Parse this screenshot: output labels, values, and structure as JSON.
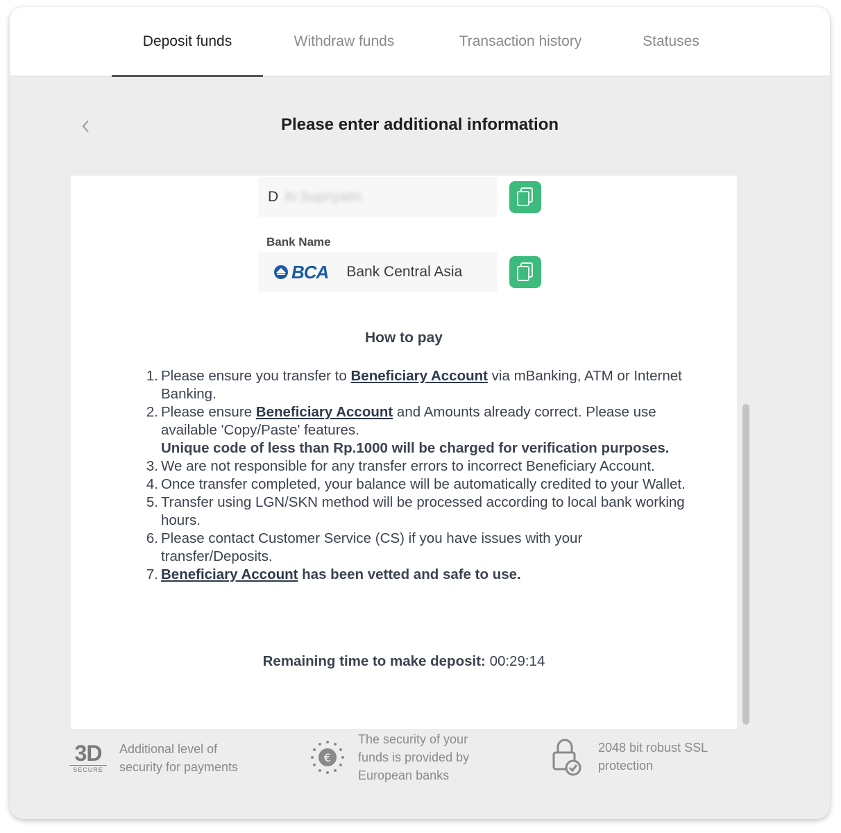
{
  "tabs": [
    {
      "label": "Deposit funds",
      "active": true
    },
    {
      "label": "Withdraw funds",
      "active": false
    },
    {
      "label": "Transaction history",
      "active": false
    },
    {
      "label": "Statuses",
      "active": false
    }
  ],
  "header": {
    "title": "Please enter additional information",
    "back_icon": "chevron-left-icon"
  },
  "account_name": {
    "visible_initial": "D",
    "masked_text": "Ai Supriyatin",
    "copy_icon": "copy-icon"
  },
  "bank": {
    "label": "Bank Name",
    "logo_text": "BCA",
    "name": "Bank Central Asia",
    "copy_icon": "copy-icon"
  },
  "how_to_pay": {
    "title": "How to pay",
    "link_text": "Beneficiary Account",
    "steps": [
      {
        "num": "1.",
        "pre": "Please ensure you transfer to ",
        "post": " via mBanking, ATM or Internet Banking."
      },
      {
        "num": "2.",
        "pre": "Please ensure ",
        "post": " and Amounts already correct. Please use available 'Copy/Paste' features.",
        "bold_note": "Unique code of less than Rp.1000 will be charged for verification purposes."
      },
      {
        "num": "3.",
        "text": "We are not responsible for any transfer errors to incorrect Beneficiary Account."
      },
      {
        "num": "4.",
        "text": "Once transfer completed, your balance will be automatically credited to your Wallet."
      },
      {
        "num": "5.",
        "text": "Transfer using LGN/SKN method will be processed according to local bank working hours."
      },
      {
        "num": "6.",
        "text": "Please contact Customer Service (CS) if you have issues with your transfer/Deposits."
      },
      {
        "num": "7.",
        "post": " has been vetted and safe to use."
      }
    ]
  },
  "remaining": {
    "label": "Remaining time to make deposit:",
    "value": "00:29:14"
  },
  "footer": {
    "secure3d": {
      "logo_main": "3D",
      "logo_sub": "SECURE",
      "text_line1": "Additional level of",
      "text_line2": "security for payments"
    },
    "banks": {
      "icon": "euro-stars-icon",
      "text_line1": "The security of your",
      "text_line2": "funds is provided by",
      "text_line3": "European banks"
    },
    "ssl": {
      "icon": "lock-check-icon",
      "text_line1": "2048 bit robust SSL",
      "text_line2": "protection"
    }
  },
  "colors": {
    "copy_button": "#3dbb7c",
    "bca_blue": "#1b5aa6",
    "background": "#ededed"
  }
}
